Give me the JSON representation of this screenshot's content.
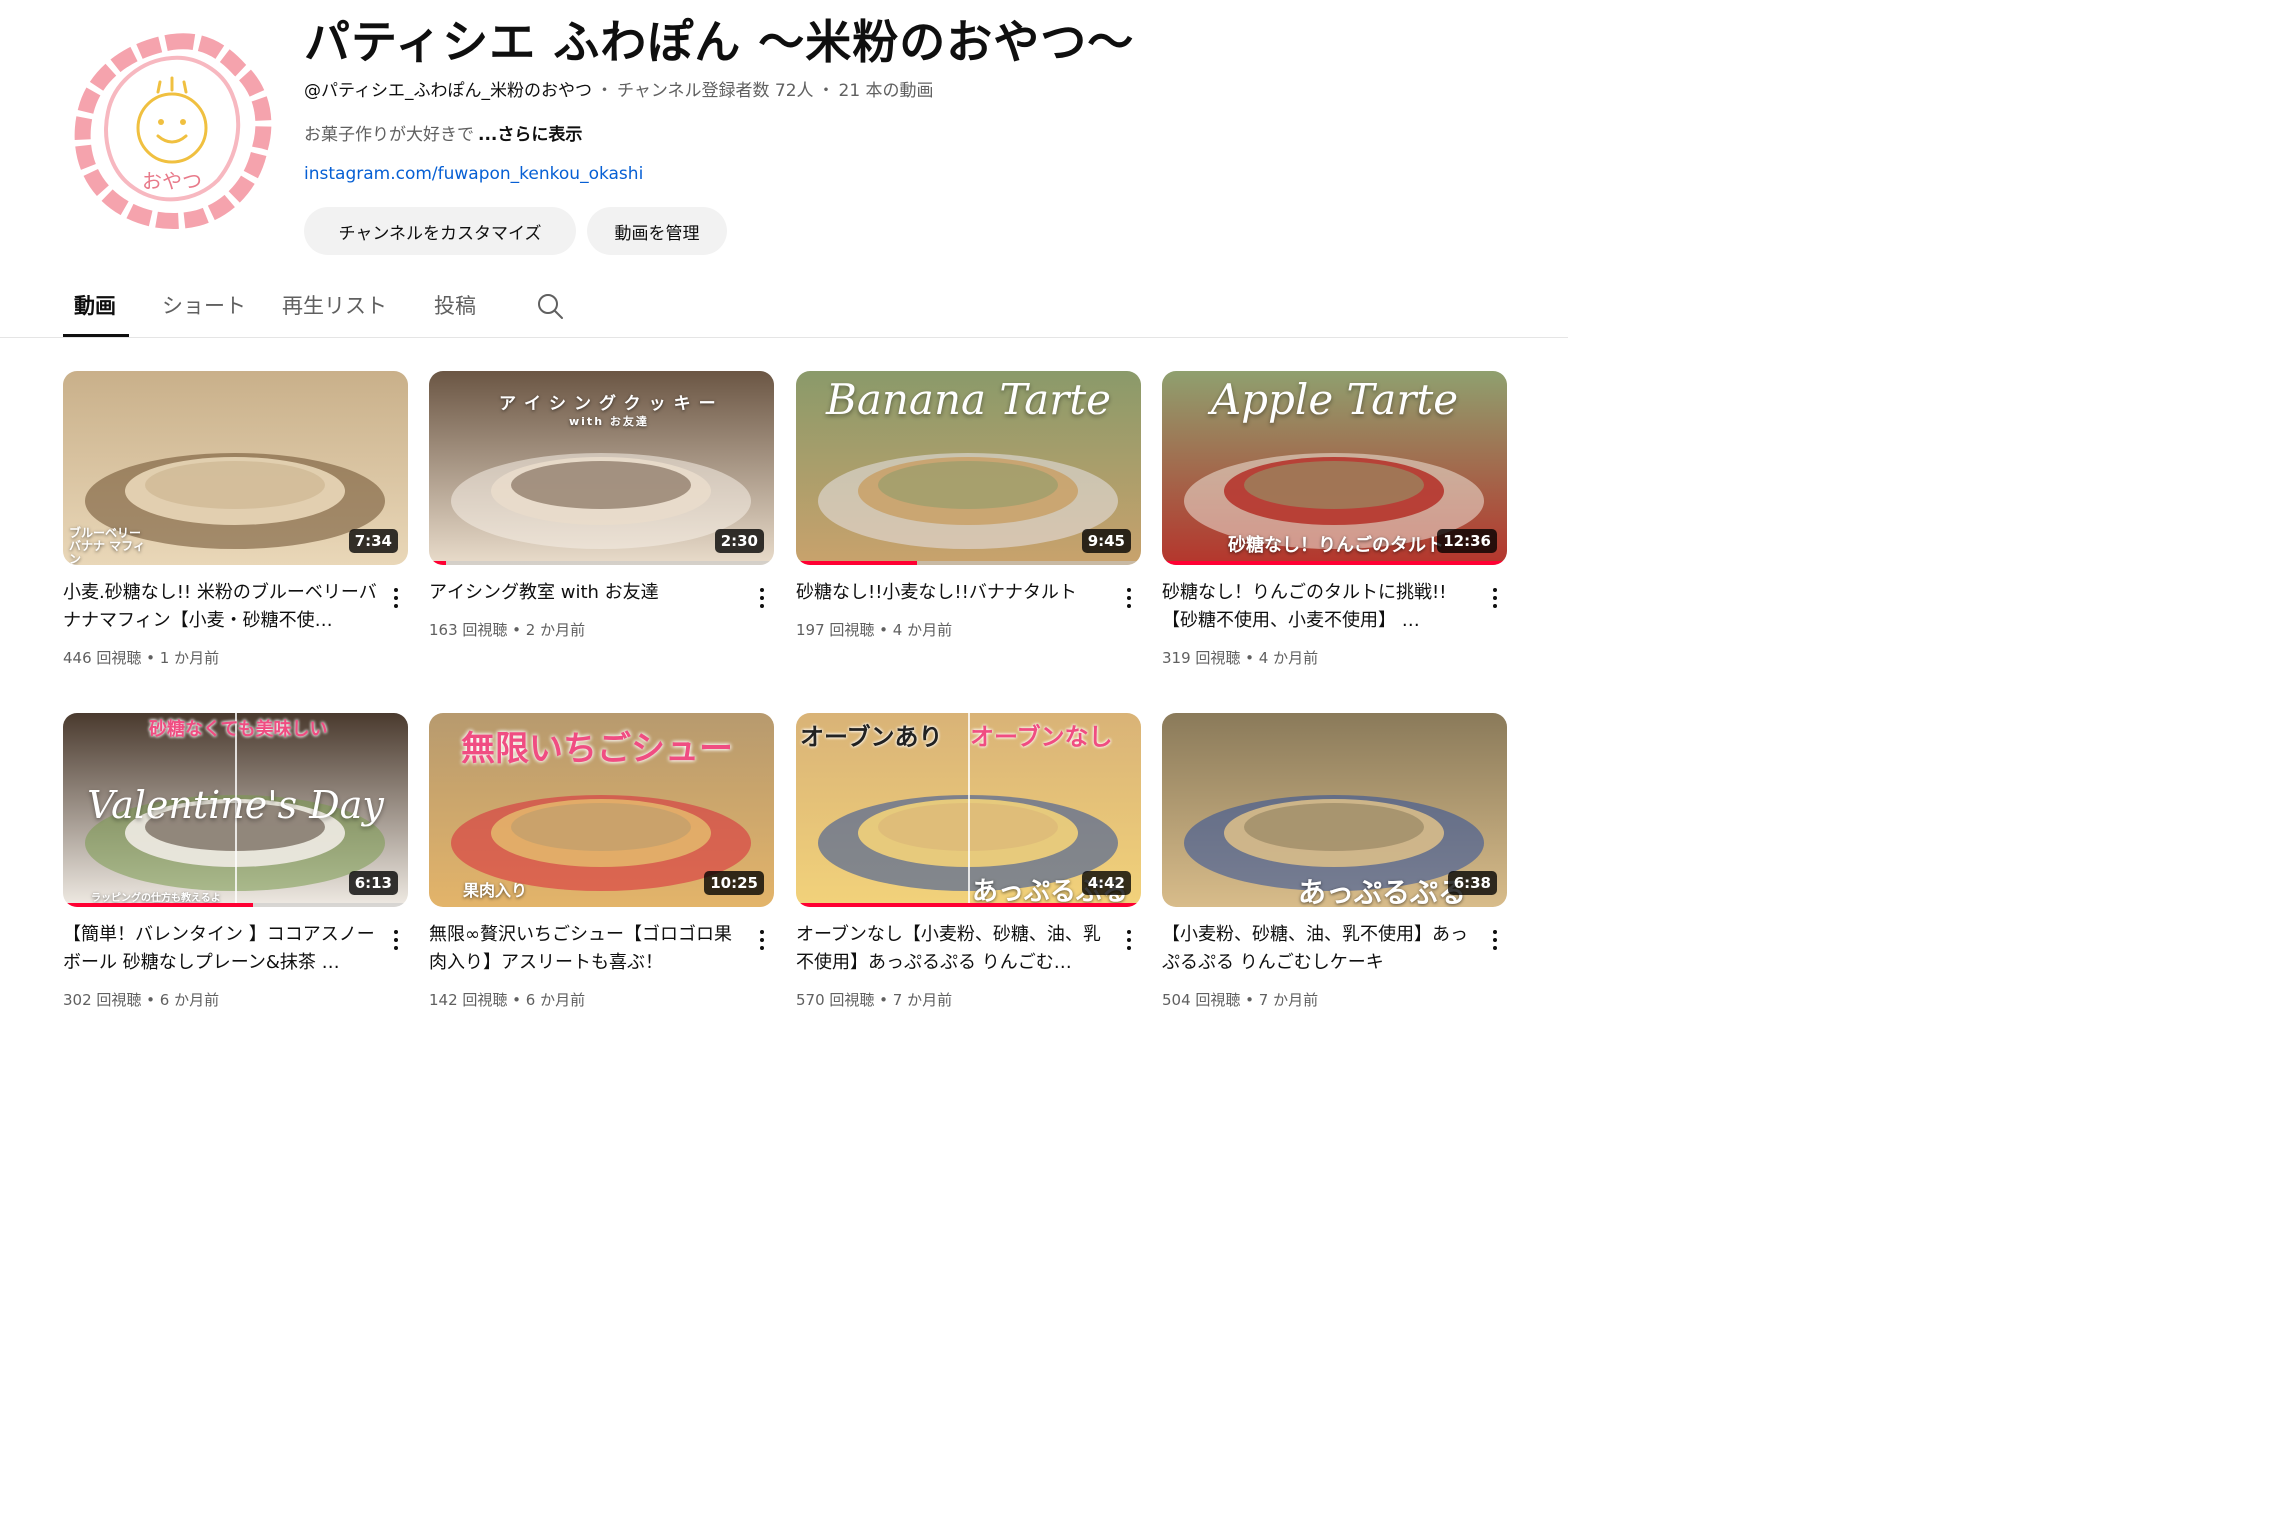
{
  "channel": {
    "name": "パティシエ ふわぽん 〜米粉のおやつ〜",
    "handle": "@パティシエ_ふわぽん_米粉のおやつ",
    "subscribers": "チャンネル登録者数 72人",
    "video_count": "21 本の動画",
    "meta_separator": "・",
    "description": "お菓子作りが大好きで",
    "show_more": "...さらに表示",
    "link": "instagram.com/fuwapon_kenkou_okashi",
    "avatar_text": "おやつ",
    "avatar_colors": {
      "ring": "#f5a3ad",
      "face": "#f0c040"
    }
  },
  "buttons": {
    "customize": "チャンネルをカスタマイズ",
    "manage": "動画を管理"
  },
  "tabs": [
    {
      "label": "動画",
      "active": true
    },
    {
      "label": "ショート",
      "active": false
    },
    {
      "label": "再生リスト",
      "active": false
    },
    {
      "label": "投稿",
      "active": false
    }
  ],
  "colors": {
    "accent": "#ff0033",
    "link": "#065fd4",
    "muted": "#606060"
  },
  "videos": [
    {
      "title": "小麦.砂糖なし!! 米粉のブルーベリーバナナマフィン【小麦・砂糖不使…",
      "views": "446 回視聴",
      "age": "1 か月前",
      "duration": "7:34",
      "thumb_text": "ブルーベリー バナナ マフィン",
      "progress": 0,
      "thumb_colors": [
        "#c9b08a",
        "#e9d7b8",
        "#6b4e2e"
      ]
    },
    {
      "title": "アイシング教室 with お友達",
      "views": "163 回視聴",
      "age": "2 か月前",
      "duration": "2:30",
      "thumb_text": "アイシングクッキー",
      "thumb_sub": "with お友達",
      "progress": 0.05,
      "thumb_colors": [
        "#6b5644",
        "#e9dccb",
        "#f5efe6"
      ]
    },
    {
      "title": "砂糖なし!!小麦なし!!バナナタルト",
      "views": "197 回視聴",
      "age": "4 か月前",
      "duration": "9:45",
      "thumb_text": "Banana Tarte",
      "progress": 0.35,
      "thumb_colors": [
        "#8a9a6a",
        "#c9a26c",
        "#e7e3ea"
      ]
    },
    {
      "title": "砂糖なし！りんごのタルトに挑戦!!【砂糖不使用、小麦不使用】 …",
      "views": "319 回視聴",
      "age": "4 か月前",
      "duration": "12:36",
      "thumb_text": "Apple Tarte",
      "thumb_sub": "砂糖なし！りんごのタルト",
      "progress": 1.0,
      "thumb_colors": [
        "#8fa06f",
        "#b5352c",
        "#efe4d8"
      ]
    },
    {
      "title": "【簡単！バレンタイン 】ココアスノーボール 砂糖なしプレーン&抹茶 …",
      "views": "302 回視聴",
      "age": "6 か月前",
      "duration": "6:13",
      "thumb_text": "Valentine's Day",
      "thumb_sub": "砂糖なくても美味しい",
      "thumb_foot": "ラッピングの仕方も教えるよ",
      "progress": 0.55,
      "thumb_colors": [
        "#4a3a2e",
        "#f0ebe4",
        "#7a9a4e"
      ]
    },
    {
      "title": "無限∞贅沢いちごシュー【ゴロゴロ果肉入り】アスリートも喜ぶ！",
      "views": "142 回視聴",
      "age": "6 か月前",
      "duration": "10:25",
      "thumb_text": "無限いちごシュー",
      "thumb_sub": "果肉入り",
      "progress": 0,
      "thumb_colors": [
        "#b79a6e",
        "#e3b46a",
        "#d8283a"
      ]
    },
    {
      "title": "オーブンなし【小麦粉、砂糖、油、乳不使用】あっぷるぷる りんごむ…",
      "views": "570 回視聴",
      "age": "7 か月前",
      "duration": "4:42",
      "thumb_text": "オーブンあり",
      "thumb_sub": "オーブンなし",
      "thumb_foot": "あっぷるぷる",
      "progress": 1.0,
      "thumb_colors": [
        "#d9b377",
        "#f2d27a",
        "#2a4d9a"
      ]
    },
    {
      "title": "【小麦粉、砂糖、油、乳不使用】あっぷるぷる りんごむしケーキ",
      "views": "504 回視聴",
      "age": "7 か月前",
      "duration": "6:38",
      "thumb_text": "あっぷるぷる",
      "progress": 0,
      "thumb_colors": [
        "#8a7a5a",
        "#d8bc8a",
        "#2a4d9a"
      ]
    }
  ]
}
